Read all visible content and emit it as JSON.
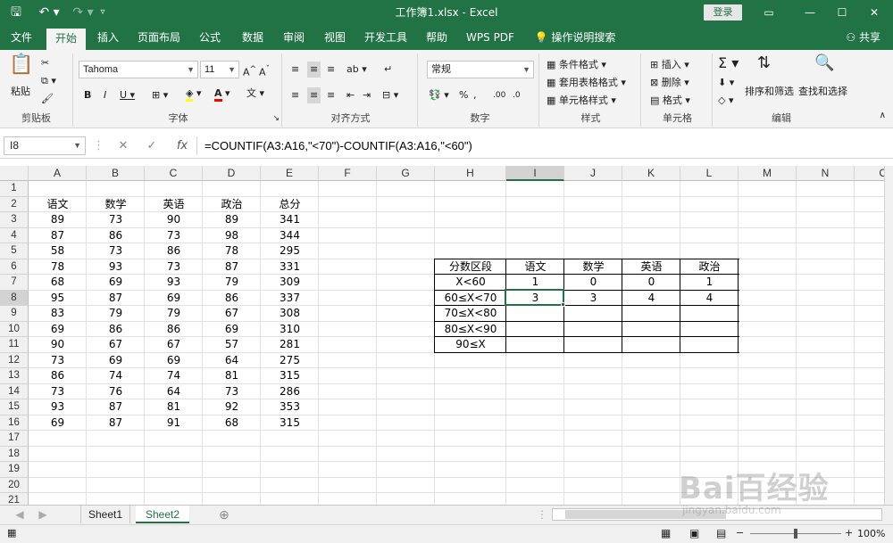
{
  "titlebar": {
    "title": "工作簿1.xlsx  -  Excel",
    "login": "登录",
    "save_icon": "save-icon",
    "undo_icon": "undo-icon",
    "redo_icon": "redo-icon"
  },
  "tabs": [
    "文件",
    "开始",
    "插入",
    "页面布局",
    "公式",
    "数据",
    "审阅",
    "视图",
    "开发工具",
    "帮助",
    "WPS PDF",
    "操作说明搜索"
  ],
  "active_tab": "开始",
  "share": "共享",
  "ribbon": {
    "clipboard": {
      "label": "剪贴板",
      "paste": "粘贴"
    },
    "font": {
      "label": "字体",
      "name": "Tahoma",
      "size": "11",
      "bold": "B",
      "italic": "I",
      "underline": "U"
    },
    "alignment": {
      "label": "对齐方式"
    },
    "number": {
      "label": "数字",
      "format": "常规"
    },
    "styles": {
      "label": "样式",
      "cond": "条件格式",
      "table": "套用表格格式",
      "cell": "单元格样式"
    },
    "cells": {
      "label": "单元格",
      "insert": "插入",
      "delete": "删除",
      "format": "格式"
    },
    "editing": {
      "label": "编辑",
      "sort": "排序和筛选",
      "find": "查找和选择"
    }
  },
  "formula_bar": {
    "name_box": "I8",
    "formula": "=COUNTIF(A3:A16,\"<70\")-COUNTIF(A3:A16,\"<60\")"
  },
  "columns": [
    "A",
    "B",
    "C",
    "D",
    "E",
    "F",
    "G",
    "H",
    "I",
    "J",
    "K",
    "L",
    "M",
    "N",
    "O"
  ],
  "rows": [
    "1",
    "2",
    "3",
    "4",
    "5",
    "6",
    "7",
    "8",
    "9",
    "10",
    "11",
    "12",
    "13",
    "14",
    "15",
    "16",
    "17",
    "18",
    "19",
    "20",
    "21"
  ],
  "scores": {
    "header": [
      "语文",
      "数学",
      "英语",
      "政治",
      "总分"
    ],
    "data": [
      [
        "89",
        "73",
        "90",
        "89",
        "341"
      ],
      [
        "87",
        "86",
        "73",
        "98",
        "344"
      ],
      [
        "58",
        "73",
        "86",
        "78",
        "295"
      ],
      [
        "78",
        "93",
        "73",
        "87",
        "331"
      ],
      [
        "68",
        "69",
        "93",
        "79",
        "309"
      ],
      [
        "95",
        "87",
        "69",
        "86",
        "337"
      ],
      [
        "83",
        "79",
        "79",
        "67",
        "308"
      ],
      [
        "69",
        "86",
        "86",
        "69",
        "310"
      ],
      [
        "90",
        "67",
        "67",
        "57",
        "281"
      ],
      [
        "73",
        "69",
        "69",
        "64",
        "275"
      ],
      [
        "86",
        "74",
        "74",
        "81",
        "315"
      ],
      [
        "73",
        "76",
        "64",
        "73",
        "286"
      ],
      [
        "93",
        "87",
        "81",
        "92",
        "353"
      ],
      [
        "69",
        "87",
        "91",
        "68",
        "315"
      ]
    ]
  },
  "summary": {
    "header": [
      "分数区段",
      "语文",
      "数学",
      "英语",
      "政治"
    ],
    "data": [
      [
        "X<60",
        "1",
        "0",
        "0",
        "1"
      ],
      [
        "60≤X<70",
        "3",
        "3",
        "4",
        "4"
      ],
      [
        "70≤X<80",
        "",
        "",
        "",
        ""
      ],
      [
        "80≤X<90",
        "",
        "",
        "",
        ""
      ],
      [
        "90≤X",
        "",
        "",
        "",
        ""
      ]
    ]
  },
  "sheets": [
    "Sheet1",
    "Sheet2"
  ],
  "active_sheet": "Sheet2",
  "status": {
    "zoom": "100%"
  },
  "watermark": "Bai百经验",
  "watermark_url": "jingyan.baidu.com",
  "colors": {
    "excel_green": "#217346"
  }
}
